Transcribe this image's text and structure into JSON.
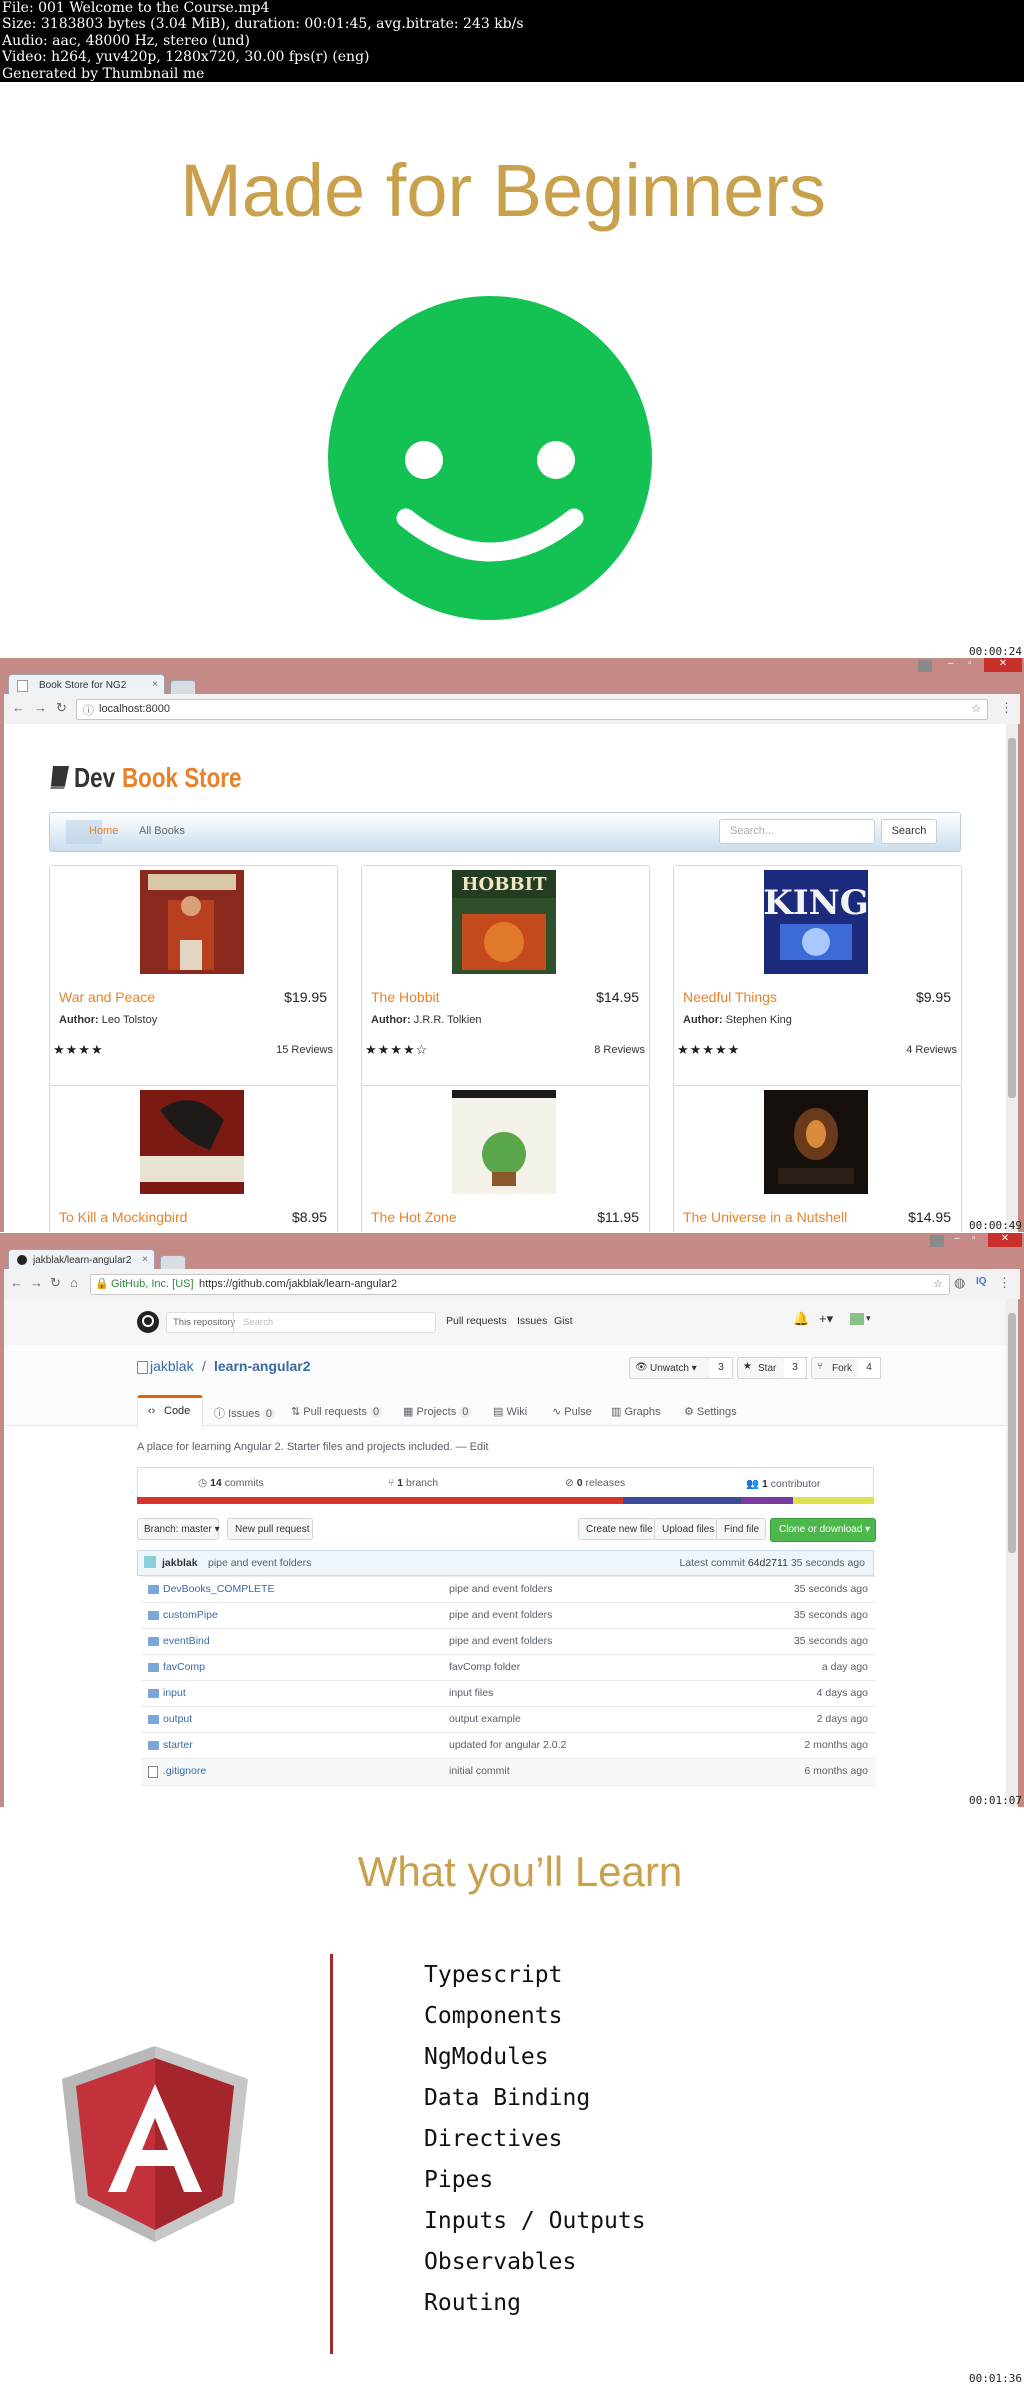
{
  "info": {
    "lines": [
      "File: 001 Welcome to the Course.mp4",
      "Size: 3183803 bytes (3.04 MiB), duration: 00:01:45, avg.bitrate: 243 kb/s",
      "Audio: aac, 48000 Hz, stereo (und)",
      "Video: h264, yuv420p, 1280x720, 30.00 fps(r) (eng)",
      "Generated by Thumbnail me"
    ]
  },
  "frame1": {
    "title": "Made for Beginners",
    "smiley_color": "#14c254",
    "title_color": "#c9a04c",
    "timestamp": "00:00:24"
  },
  "frame2": {
    "tab_title": "Book Store for NG2",
    "url": "localhost:8000",
    "logo_dev": "Dev",
    "logo_store": "Book Store",
    "nav": {
      "home": "Home",
      "all_books": "All Books"
    },
    "search_placeholder": "Search...",
    "search_button": "Search",
    "books": [
      {
        "title": "War and Peace",
        "price": "$19.95",
        "author_label": "Author:",
        "author": "Leo Tolstoy",
        "stars": "★★★★",
        "reviews": "15 Reviews"
      },
      {
        "title": "The Hobbit",
        "price": "$14.95",
        "author_label": "Author:",
        "author": "J.R.R. Tolkien",
        "stars": "★★★★☆",
        "reviews": "8 Reviews"
      },
      {
        "title": "Needful Things",
        "price": "$9.95",
        "author_label": "Author:",
        "author": "Stephen King",
        "stars": "★★★★★",
        "reviews": "4 Reviews"
      },
      {
        "title": "To Kill a Mockingbird",
        "price": "$8.95"
      },
      {
        "title": "The Hot Zone",
        "price": "$11.95"
      },
      {
        "title": "The Universe in a Nutshell",
        "price": "$14.95"
      }
    ],
    "timestamp": "00:00:49"
  },
  "frame3": {
    "tab_title": "jakblak/learn-angular2",
    "url_secure": "GitHub, Inc. [US]",
    "url": "https://github.com/jakblak/learn-angular2",
    "header": {
      "search_scope": "This repository",
      "search_placeholder": "Search",
      "links": [
        "Pull requests",
        "Issues",
        "Gist"
      ]
    },
    "repo_owner": "jakblak",
    "repo_sep": "/",
    "repo_name": "learn-angular2",
    "actions": {
      "unwatch": "Unwatch ▾",
      "unwatch_count": "3",
      "star": "Star",
      "star_count": "3",
      "fork": "Fork",
      "fork_count": "4"
    },
    "tabs": [
      {
        "label": "Code",
        "count": ""
      },
      {
        "label": "Issues",
        "count": "0"
      },
      {
        "label": "Pull requests",
        "count": "0"
      },
      {
        "label": "Projects",
        "count": "0"
      },
      {
        "label": "Wiki",
        "count": ""
      },
      {
        "label": "Pulse",
        "count": ""
      },
      {
        "label": "Graphs",
        "count": ""
      },
      {
        "label": "Settings",
        "count": ""
      }
    ],
    "description": "A place for learning Angular 2. Starter files and projects included. — Edit",
    "stats": {
      "commits_n": "14",
      "commits": "commits",
      "branch_n": "1",
      "branch": "branch",
      "releases_n": "0",
      "releases": "releases",
      "contrib_n": "1",
      "contrib": "contributor"
    },
    "branch_button": "Branch: master ▾",
    "new_pr_button": "New pull request",
    "create_file": "Create new file",
    "upload_files": "Upload files",
    "find_file": "Find file",
    "clone_button": "Clone or download ▾",
    "commit": {
      "author": "jakblak",
      "message": "pipe and event folders",
      "latest_label": "Latest commit",
      "sha": "64d2711",
      "age": "35 seconds ago"
    },
    "files": [
      {
        "name": "DevBooks_COMPLETE",
        "message": "pipe and event folders",
        "age": "35 seconds ago"
      },
      {
        "name": "customPipe",
        "message": "pipe and event folders",
        "age": "35 seconds ago"
      },
      {
        "name": "eventBind",
        "message": "pipe and event folders",
        "age": "35 seconds ago"
      },
      {
        "name": "favComp",
        "message": "favComp folder",
        "age": "a day ago"
      },
      {
        "name": "input",
        "message": "input files",
        "age": "4 days ago"
      },
      {
        "name": "output",
        "message": "output example",
        "age": "2 days ago"
      },
      {
        "name": "starter",
        "message": "updated for angular 2.0.2",
        "age": "2 months ago"
      },
      {
        "name": ".gitignore",
        "message": "initial commit",
        "age": "6 months ago"
      }
    ],
    "timestamp": "00:01:07"
  },
  "frame4": {
    "title": "What you’ll Learn",
    "items": [
      "Typescript",
      "Components",
      "NgModules",
      "Data Binding",
      "Directives",
      "Pipes",
      "Inputs / Outputs",
      "Observables",
      "Routing"
    ],
    "divider_color": "#a32a2a",
    "timestamp": "00:01:36"
  }
}
